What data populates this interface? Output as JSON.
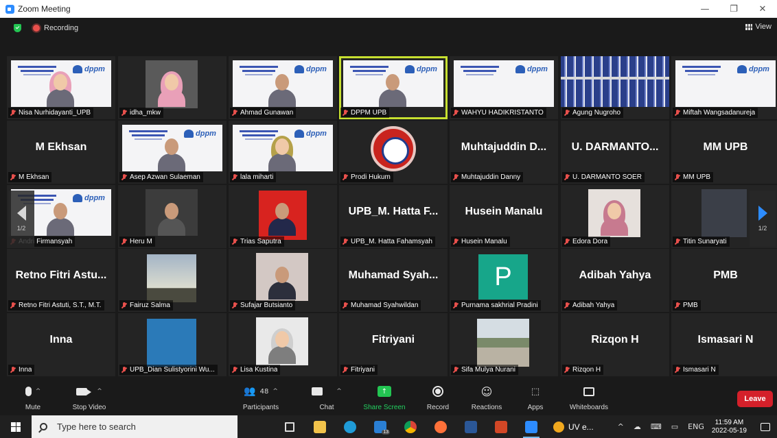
{
  "window": {
    "title": "Zoom Meeting",
    "minimize": "—",
    "maximize": "❐",
    "close": "✕"
  },
  "status": {
    "recording_label": "Recording",
    "view_label": "View"
  },
  "pager": {
    "left_page": "1/2",
    "right_page": "1/2"
  },
  "tiles": [
    {
      "label": "Nisa Nurhidayanti_UPB",
      "kind": "slide-person-hijab"
    },
    {
      "label": "idha_mkw",
      "kind": "video-hijab"
    },
    {
      "label": "Ahmad Gunawan",
      "kind": "slide-person"
    },
    {
      "label": "DPPM UPB",
      "kind": "slide-person-active"
    },
    {
      "label": "WAHYU HADIKRISTANTO",
      "kind": "slide"
    },
    {
      "label": "Agung Nugroho",
      "kind": "bookshelf"
    },
    {
      "label": "Miftah Wangsadanureja",
      "kind": "slide"
    },
    {
      "label": "M Ekhsan",
      "big": "M Ekhsan",
      "kind": "name"
    },
    {
      "label": "Asep Azwan Sulaeman",
      "kind": "slide-person"
    },
    {
      "label": "lala miharti",
      "kind": "slide-person-green"
    },
    {
      "label": "Prodi Hukum",
      "kind": "hukum"
    },
    {
      "label": "Muhtajuddin Danny",
      "big": "Muhtajuddin D...",
      "kind": "name"
    },
    {
      "label": "U. DARMANTO SOER",
      "big": "U. DARMANTO...",
      "kind": "name"
    },
    {
      "label": "MM UPB",
      "big": "MM UPB",
      "kind": "name"
    },
    {
      "label": "Andri Firmansyah",
      "kind": "slide-person"
    },
    {
      "label": "Heru M",
      "kind": "photo-dark"
    },
    {
      "label": "Trias Saputra",
      "kind": "photo-red"
    },
    {
      "label": "UPB_M. Hatta Fahamsyah",
      "big": "UPB_M. Hatta F...",
      "kind": "name"
    },
    {
      "label": "Husein Manalu",
      "big": "Husein Manalu",
      "kind": "name"
    },
    {
      "label": "Edora Dora",
      "kind": "photo-hijab"
    },
    {
      "label": "Titin Sunaryati",
      "kind": "photo-grey"
    },
    {
      "label": "Retno Fitri Astuti, S.T., M.T.",
      "big": "Retno Fitri Astu...",
      "kind": "name"
    },
    {
      "label": "Fairuz Salma",
      "kind": "photo-sky"
    },
    {
      "label": "Sufajar Butsianto",
      "kind": "photo-light"
    },
    {
      "label": "Muhamad Syahwildan",
      "big": "Muhamad Syah...",
      "kind": "name"
    },
    {
      "label": "Purnama sakhrial Pradini",
      "kind": "avatar",
      "avatar_letter": "P",
      "avatar_color": "#17a68a"
    },
    {
      "label": "Adibah Yahya",
      "big": "Adibah Yahya",
      "kind": "name"
    },
    {
      "label": "PMB",
      "big": "PMB",
      "kind": "name"
    },
    {
      "label": "Inna",
      "big": "Inna",
      "kind": "name"
    },
    {
      "label": "UPB_Dian Sulistyorini Wu...",
      "kind": "photo-blue"
    },
    {
      "label": "Lisa Kustina",
      "kind": "photo-hijab-grey"
    },
    {
      "label": "Fitriyani",
      "big": "Fitriyani",
      "kind": "name"
    },
    {
      "label": "Sifa Mulya Nurani",
      "kind": "photo-street"
    },
    {
      "label": "Rizqon H",
      "big": "Rizqon H",
      "kind": "name"
    },
    {
      "label": "Ismasari N",
      "big": "Ismasari N",
      "kind": "name"
    }
  ],
  "toolbar": {
    "mute": "Mute",
    "stop_video": "Stop Video",
    "participants": "Participants",
    "participants_count": "48",
    "chat": "Chat",
    "share_screen": "Share Screen",
    "record": "Record",
    "reactions": "Reactions",
    "apps": "Apps",
    "whiteboards": "Whiteboards",
    "leave": "Leave"
  },
  "taskbar": {
    "search_placeholder": "Type here to search",
    "uv_label": "UV e...",
    "mail_badge": "13",
    "lang": "ENG",
    "time": "11:59 AM",
    "date": "2022-05-19"
  },
  "colors": {
    "accent_green": "#23c552",
    "leave_red": "#d4202a",
    "zoom_blue": "#2d8cff",
    "active_outline": "#c7e030"
  }
}
